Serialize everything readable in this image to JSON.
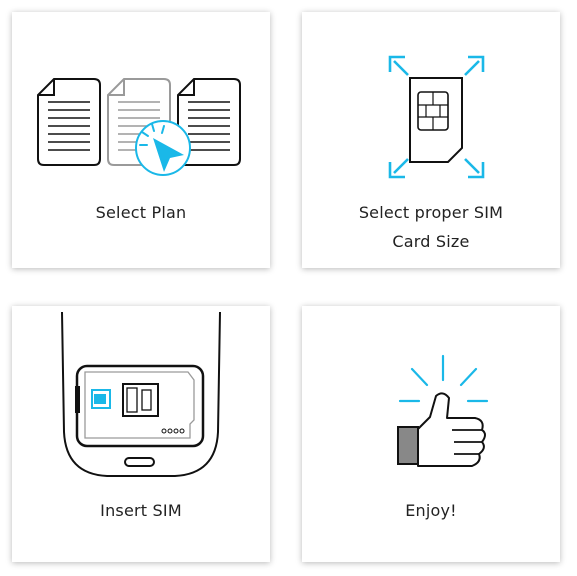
{
  "colors": {
    "accent": "#1ab8e8",
    "outline": "#111111",
    "muted": "#9a9a9a",
    "thumb_cuff": "#888888",
    "card_bg": "#ffffff"
  },
  "steps": [
    {
      "caption_lines": [
        "Select Plan"
      ],
      "icons": [
        "document-icon",
        "document-icon",
        "document-icon",
        "cursor-click-icon"
      ]
    },
    {
      "caption_lines": [
        "Select proper SIM",
        "Card Size"
      ],
      "icons": [
        "sim-card-icon",
        "scan-frame-icon"
      ]
    },
    {
      "caption_lines": [
        "Insert SIM"
      ],
      "icons": [
        "phone-sim-tray-icon"
      ]
    },
    {
      "caption_lines": [
        "Enjoy!"
      ],
      "icons": [
        "thumbs-up-icon"
      ]
    }
  ]
}
